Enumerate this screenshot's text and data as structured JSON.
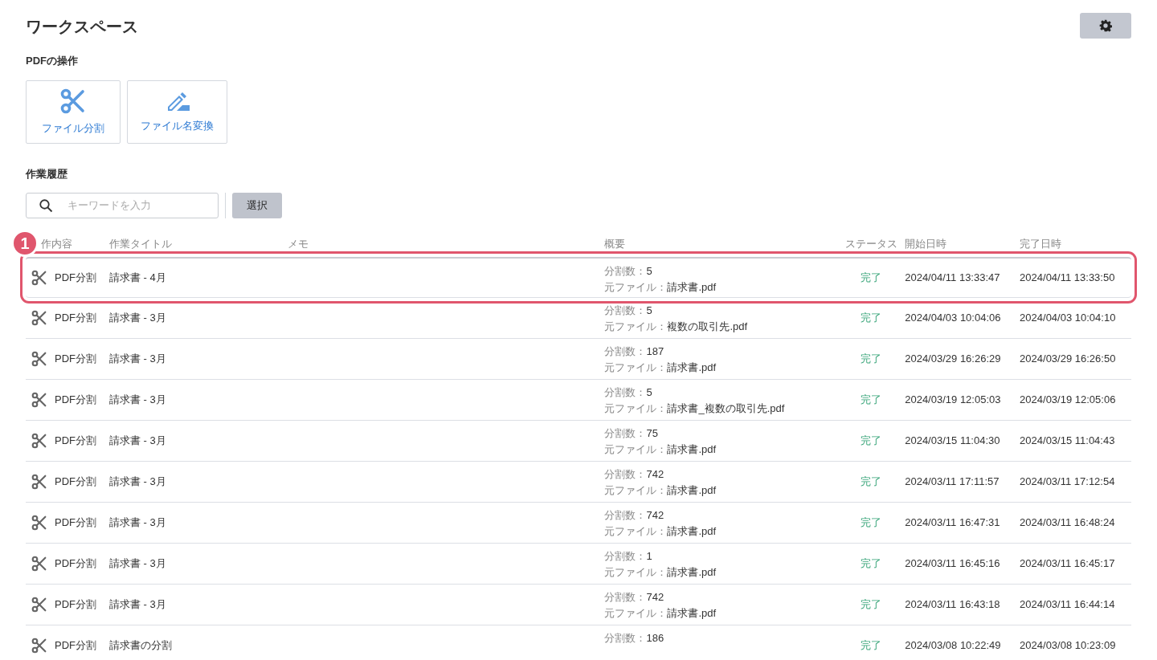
{
  "title": "ワークスペース",
  "operations": {
    "heading": "PDFの操作",
    "items": [
      {
        "kind": "split",
        "label": "ファイル分割"
      },
      {
        "kind": "rename",
        "label": "ファイル名変換"
      }
    ]
  },
  "history": {
    "heading": "作業履歴",
    "search": {
      "placeholder": "キーワードを入力"
    },
    "select_button": "選択"
  },
  "table": {
    "columns": [
      "作内容",
      "作業タイトル",
      "メモ",
      "概要",
      "ステータス",
      "開始日時",
      "完了日時"
    ],
    "rows": [
      {
        "highlighted": true,
        "type": "PDF分割",
        "title": "請求書 - 4月",
        "summary": [
          {
            "label": "分割数：",
            "value": "5"
          },
          {
            "label": "元ファイル：",
            "value": "請求書.pdf"
          }
        ],
        "status": "完了",
        "start": "2024/04/11 13:33:47",
        "end": "2024/04/11 13:33:50"
      },
      {
        "highlighted": false,
        "type": "PDF分割",
        "title": "請求書 - 3月",
        "summary": [
          {
            "label": "分割数：",
            "value": "5"
          },
          {
            "label": "元ファイル：",
            "value": "複数の取引先.pdf"
          }
        ],
        "status": "完了",
        "start": "2024/04/03 10:04:06",
        "end": "2024/04/03 10:04:10"
      },
      {
        "highlighted": false,
        "type": "PDF分割",
        "title": "請求書 - 3月",
        "summary": [
          {
            "label": "分割数：",
            "value": "187"
          },
          {
            "label": "元ファイル：",
            "value": "請求書.pdf"
          }
        ],
        "status": "完了",
        "start": "2024/03/29 16:26:29",
        "end": "2024/03/29 16:26:50"
      },
      {
        "highlighted": false,
        "type": "PDF分割",
        "title": "請求書 - 3月",
        "summary": [
          {
            "label": "分割数：",
            "value": "5"
          },
          {
            "label": "元ファイル：",
            "value": "請求書_複数の取引先.pdf"
          }
        ],
        "status": "完了",
        "start": "2024/03/19 12:05:03",
        "end": "2024/03/19 12:05:06"
      },
      {
        "highlighted": false,
        "type": "PDF分割",
        "title": "請求書 - 3月",
        "summary": [
          {
            "label": "分割数：",
            "value": "75"
          },
          {
            "label": "元ファイル：",
            "value": "請求書.pdf"
          }
        ],
        "status": "完了",
        "start": "2024/03/15 11:04:30",
        "end": "2024/03/15 11:04:43"
      },
      {
        "highlighted": false,
        "type": "PDF分割",
        "title": "請求書 - 3月",
        "summary": [
          {
            "label": "分割数：",
            "value": "742"
          },
          {
            "label": "元ファイル：",
            "value": "請求書.pdf"
          }
        ],
        "status": "完了",
        "start": "2024/03/11 17:11:57",
        "end": "2024/03/11 17:12:54"
      },
      {
        "highlighted": false,
        "type": "PDF分割",
        "title": "請求書 - 3月",
        "summary": [
          {
            "label": "分割数：",
            "value": "742"
          },
          {
            "label": "元ファイル：",
            "value": "請求書.pdf"
          }
        ],
        "status": "完了",
        "start": "2024/03/11 16:47:31",
        "end": "2024/03/11 16:48:24"
      },
      {
        "highlighted": false,
        "type": "PDF分割",
        "title": "請求書 - 3月",
        "summary": [
          {
            "label": "分割数：",
            "value": "1"
          },
          {
            "label": "元ファイル：",
            "value": "請求書.pdf"
          }
        ],
        "status": "完了",
        "start": "2024/03/11 16:45:16",
        "end": "2024/03/11 16:45:17"
      },
      {
        "highlighted": false,
        "type": "PDF分割",
        "title": "請求書 - 3月",
        "summary": [
          {
            "label": "分割数：",
            "value": "742"
          },
          {
            "label": "元ファイル：",
            "value": "請求書.pdf"
          }
        ],
        "status": "完了",
        "start": "2024/03/11 16:43:18",
        "end": "2024/03/11 16:44:14"
      },
      {
        "highlighted": false,
        "type": "PDF分割",
        "title": "請求書の分割",
        "summary": [
          {
            "label": "分割数：",
            "value": "186"
          }
        ],
        "status": "完了",
        "start": "2024/03/08 10:22:49",
        "end": "2024/03/08 10:23:09"
      }
    ]
  },
  "annotation": {
    "label": "1"
  }
}
